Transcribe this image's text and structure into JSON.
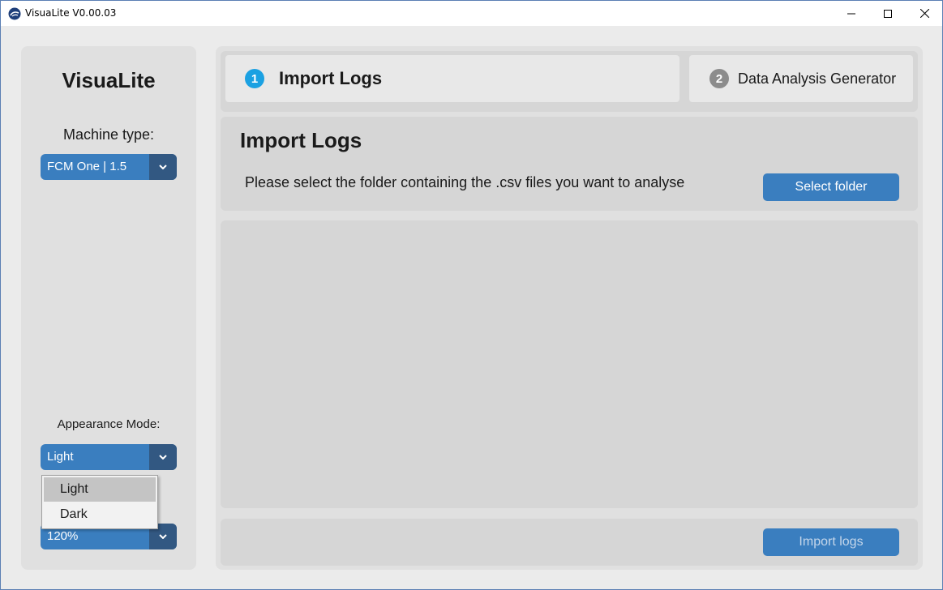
{
  "window": {
    "title": "VisuaLite V0.00.03",
    "controls": [
      "minimize-icon",
      "maximize-icon",
      "close-icon"
    ]
  },
  "sidebar": {
    "app_name": "VisuaLite",
    "machine_label": "Machine type:",
    "machine_value": "FCM One | 1.5",
    "appearance_label": "Appearance Mode:",
    "appearance_value": "Light",
    "appearance_options": [
      "Light",
      "Dark"
    ],
    "scaling_value": "120%"
  },
  "tabs": [
    {
      "number": "1",
      "label": "Import Logs",
      "active": true
    },
    {
      "number": "2",
      "label": "Data Analysis Generator",
      "active": false
    }
  ],
  "import_panel": {
    "title": "Import Logs",
    "description": "Please select the folder containing the .csv files you want to analyse",
    "select_button": "Select folder"
  },
  "footer": {
    "import_button": "Import logs"
  },
  "colors": {
    "accent": "#3a7ebf",
    "accent_dark": "#325882",
    "active_step": "#1ba1e2",
    "inactive_step": "#8c8c8c"
  }
}
